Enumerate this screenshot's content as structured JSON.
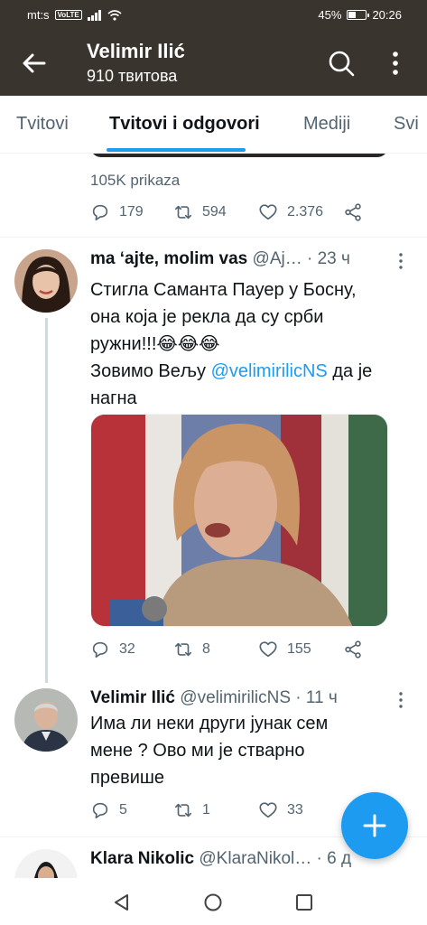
{
  "status_bar": {
    "carrier": "mt:s",
    "volte": "VoLTE",
    "battery_percent": "45%",
    "battery_level": 0.45,
    "time": "20:26"
  },
  "app_bar": {
    "title": "Velimir Ilić",
    "subtitle": "910 твитова",
    "icons": [
      "back-arrow-icon",
      "search-icon",
      "more-vertical-icon"
    ]
  },
  "tabs": [
    {
      "label": "Tvitovi",
      "active": false
    },
    {
      "label": "Tvitovi i odgovori",
      "active": true
    },
    {
      "label": "Mediji",
      "active": false
    },
    {
      "label": "Svi",
      "active": false
    }
  ],
  "accent_color": "#1d9bf0",
  "previous_tweet": {
    "views": "105K prikaza",
    "replies": "179",
    "retweets": "594",
    "likes": "2.376"
  },
  "tweets": [
    {
      "name": "ma ‘ajte, molim vas",
      "handle": "@Aj…",
      "time": "· 23 ч",
      "text_lines": [
        "Стигла Саманта Пауер у Босну,",
        "она која је рекла да су срби",
        "ружни!!!😂😂😂"
      ],
      "text_mention_prefix": "Зовимо Вељу ",
      "mention": "@velimirilicNS",
      "text_mention_suffix": " да је",
      "text_last": "нагна",
      "replies": "32",
      "retweets": "8",
      "likes": "155"
    },
    {
      "name": "Velimir Ilić",
      "handle": "@velimirilicNS",
      "time": "· 11 ч",
      "text_lines": [
        "Има ли неки други јунак сем",
        "мене ? Ово ми је стварно",
        "превише"
      ],
      "replies": "5",
      "retweets": "1",
      "likes": "33"
    },
    {
      "name": "Klara Nikolic",
      "handle": "@KlaraNikol…",
      "time": "· 6 д"
    }
  ]
}
